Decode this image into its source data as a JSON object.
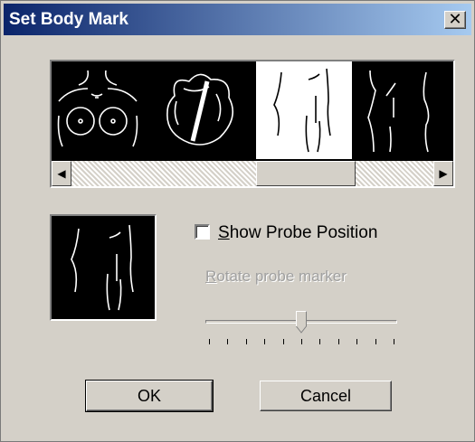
{
  "window": {
    "title": "Set Body Mark",
    "close_glyph": "✕"
  },
  "gallery": {
    "thumbnails": [
      {
        "name": "chest-breasts-mark"
      },
      {
        "name": "heart-mark"
      },
      {
        "name": "torso-front-mark",
        "selected": true
      },
      {
        "name": "torso-side-mark"
      }
    ],
    "scroll_left_glyph": "◀",
    "scroll_right_glyph": "▶"
  },
  "preview": {
    "name": "selected-body-mark-preview"
  },
  "show_probe": {
    "label_accesskey": "S",
    "label_rest": "how Probe Position",
    "checked": false
  },
  "rotate": {
    "label_accesskey": "R",
    "label_rest": "otate probe marker",
    "enabled": false,
    "value_fraction": 0.5
  },
  "buttons": {
    "ok": "OK",
    "cancel": "Cancel"
  },
  "colors": {
    "title_start": "#0a246a",
    "title_end": "#a6caf0",
    "face": "#d4d0c8"
  }
}
